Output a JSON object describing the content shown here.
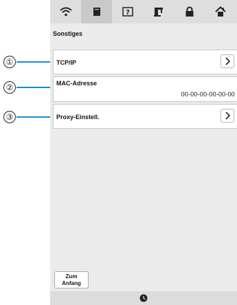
{
  "callouts": [
    "①",
    "②",
    "③"
  ],
  "topbar": {
    "tabs": [
      {
        "icon": "wifi-icon"
      },
      {
        "icon": "page-icon",
        "active": true
      },
      {
        "icon": "help-icon"
      },
      {
        "icon": "sewing-machine-icon"
      },
      {
        "icon": "lock-icon"
      },
      {
        "icon": "home-icon"
      }
    ]
  },
  "section_title": "Sonstiges",
  "rows": {
    "tcpip": {
      "label": "TCP/IP"
    },
    "mac": {
      "label": "MAC-Adresse",
      "value": "00-00-00-00-00-00"
    },
    "proxy": {
      "label": "Proxy-Einstell."
    }
  },
  "home_button": {
    "line1": "Zum",
    "line2": "Anfang"
  },
  "bottombar": {
    "icon": "clock-icon"
  },
  "colors": {
    "callout_line": "#1a8ad1",
    "screen_bg": "#ebebeb"
  }
}
